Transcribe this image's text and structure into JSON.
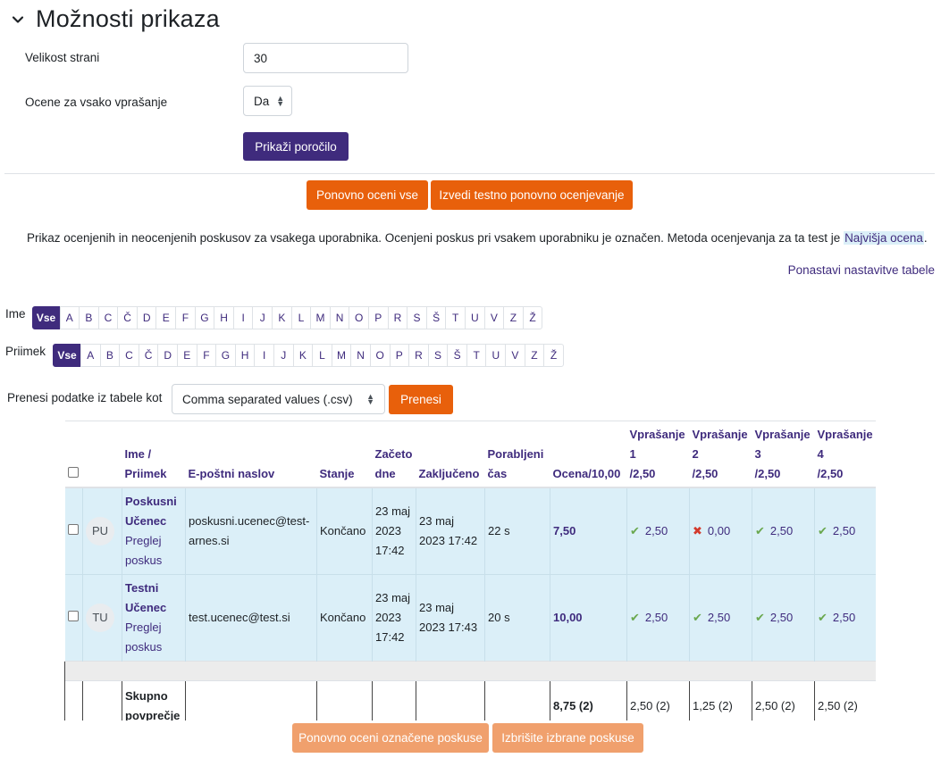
{
  "section": {
    "title": "Možnosti prikaza"
  },
  "form": {
    "page_size_label": "Velikost strani",
    "page_size_value": "30",
    "per_question_label": "Ocene za vsako vprašanje",
    "per_question_value": "Da",
    "show_report_label": "Prikaži poročilo"
  },
  "actions": {
    "regrade_all": "Ponovno oceni vse",
    "dry_run": "Izvedi testno ponovno ocenjevanje"
  },
  "info": {
    "text": "Prikaz ocenjenih in neocenjenih poskusov za vsakega uporabnika. Ocenjeni poskus pri vsakem uporabniku je označen. Metoda ocenjevanja za ta test je ",
    "method": "Najvišja ocena",
    "end": "."
  },
  "reset_link": "Ponastavi nastavitve tabele",
  "initials": {
    "first_label": "Ime",
    "last_label": "Priimek",
    "all": "Vse",
    "letters": [
      "A",
      "B",
      "C",
      "Č",
      "D",
      "E",
      "F",
      "G",
      "H",
      "I",
      "J",
      "K",
      "L",
      "M",
      "N",
      "O",
      "P",
      "R",
      "S",
      "Š",
      "T",
      "U",
      "V",
      "Z",
      "Ž"
    ]
  },
  "download": {
    "label": "Prenesi podatke iz tabele kot",
    "format": "Comma separated values (.csv)",
    "button": "Prenesi"
  },
  "table": {
    "headers": {
      "name": "Ime /",
      "name2": "Priimek",
      "email": "E-poštni naslov",
      "state": "Stanje",
      "started1": "Začeto",
      "started2": "dne",
      "finished": "Zaključeno",
      "time1": "Porabljeni",
      "time2": "čas",
      "grade": "Ocena/10,00",
      "q1a": "Vprašanje",
      "q1b": "1",
      "q1c": "/2,50",
      "q2a": "Vprašanje",
      "q2b": "2",
      "q2c": "/2,50",
      "q3a": "Vprašanje",
      "q3b": "3",
      "q3c": "/2,50",
      "q4a": "Vprašanje",
      "q4b": "4",
      "q4c": "/2,50"
    },
    "rows": [
      {
        "initials": "PU",
        "first": "Poskusni",
        "last": "Učenec",
        "review": "Preglej",
        "review2": "poskus",
        "email1": "poskusni.ucenec@test-",
        "email2": "arnes.si",
        "state": "Končano",
        "started1": "23 maj",
        "started2": "2023",
        "started3": "17:42",
        "finished1": "23 maj",
        "finished2": "2023 17:42",
        "time": "22 s",
        "grade": "7,50",
        "q": [
          "2,50",
          "0,00",
          "2,50",
          "2,50"
        ],
        "q_status": [
          "correct",
          "incorrect",
          "correct",
          "correct"
        ]
      },
      {
        "initials": "TU",
        "first": "Testni",
        "last": "Učenec",
        "review": "Preglej",
        "review2": "poskus",
        "email1": "test.ucenec@test.si",
        "email2": "",
        "state": "Končano",
        "started1": "23 maj",
        "started2": "2023",
        "started3": "17:42",
        "finished1": "23 maj",
        "finished2": "2023 17:43",
        "time": "20 s",
        "grade": "10,00",
        "q": [
          "2,50",
          "2,50",
          "2,50",
          "2,50"
        ],
        "q_status": [
          "correct",
          "correct",
          "correct",
          "correct"
        ]
      }
    ],
    "average": {
      "label1": "Skupno",
      "label2": "povprečje",
      "grade": "8,75 (2)",
      "q": [
        "2,50 (2)",
        "1,25 (2)",
        "2,50 (2)",
        "2,50 (2)"
      ]
    }
  },
  "bottom_actions": {
    "regrade_selected": "Ponovno oceni označene poskuse",
    "delete_selected": "Izbrišite izbrane poskuse"
  },
  "colors": {
    "primary": "#3f2b7d",
    "accent": "#e8600b",
    "row_highlight": "#dbeff8"
  }
}
